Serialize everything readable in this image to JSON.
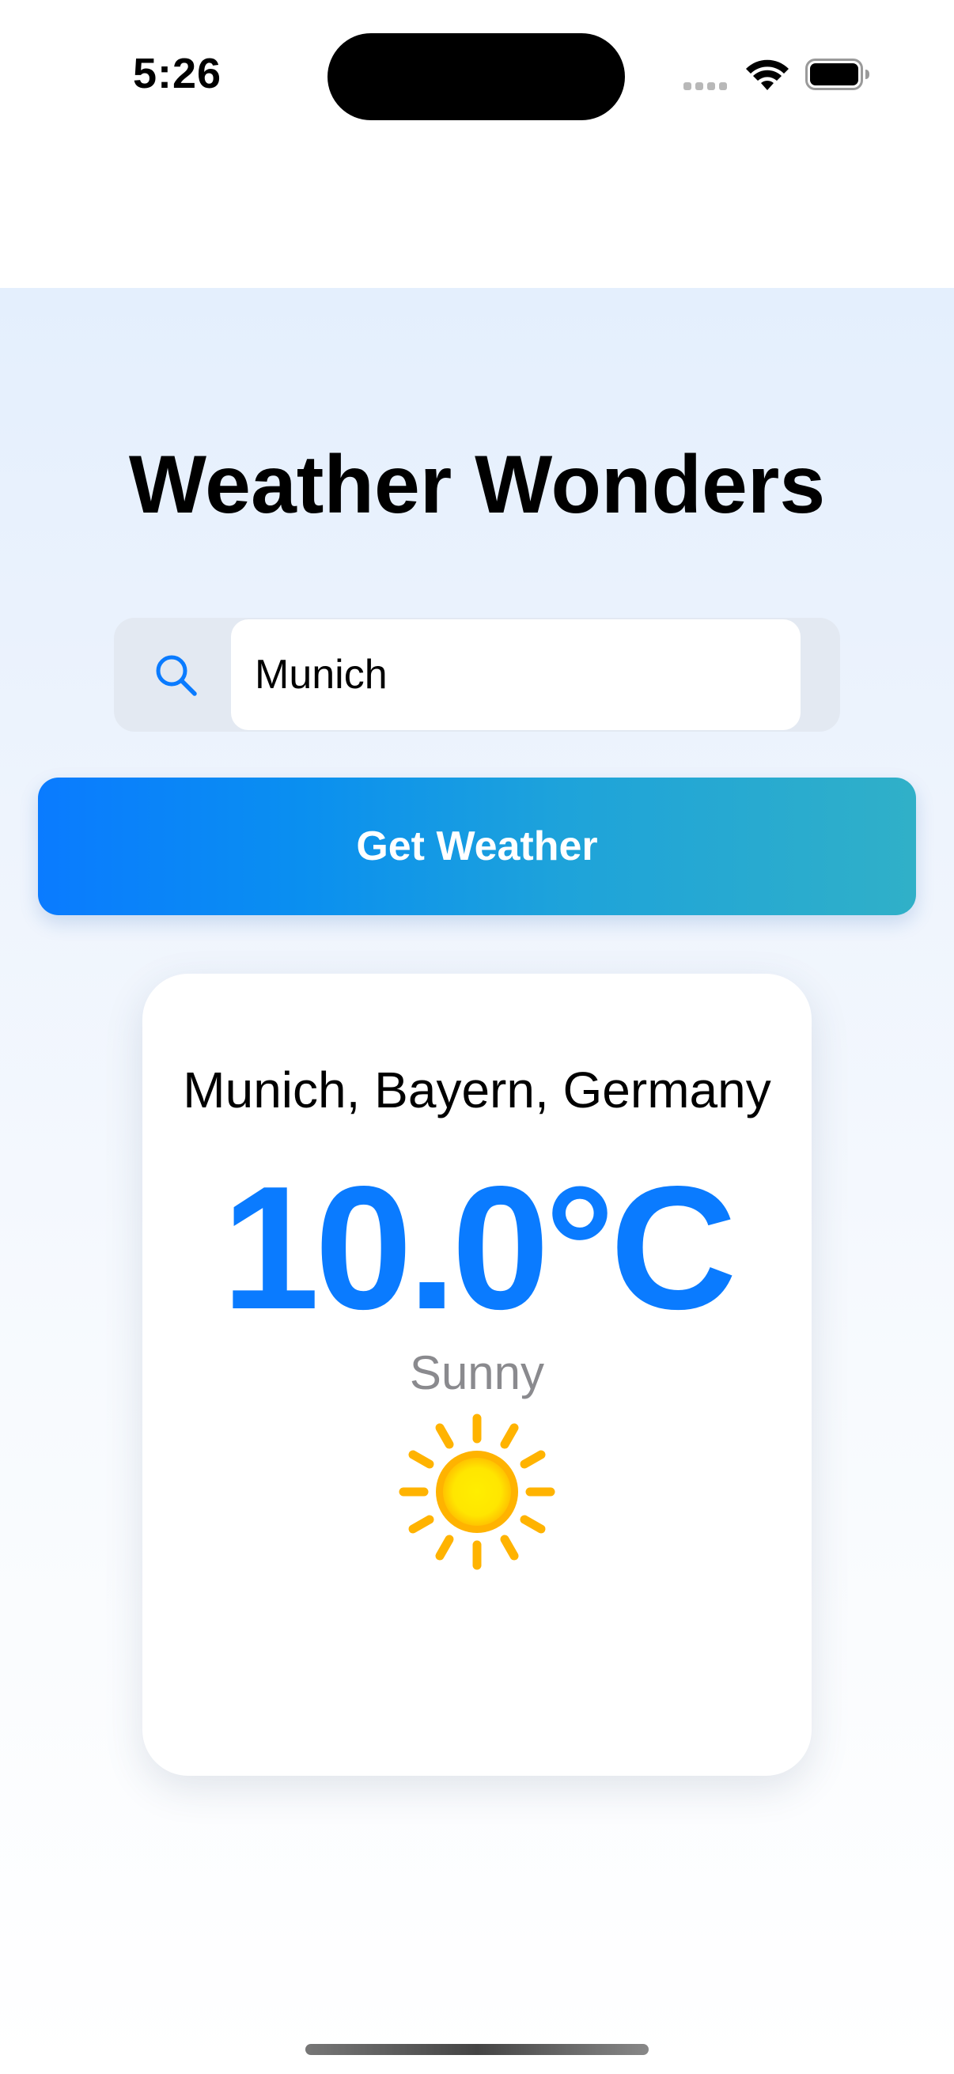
{
  "status_bar": {
    "time": "5:26"
  },
  "app": {
    "title": "Weather Wonders"
  },
  "search": {
    "value": "Munich",
    "icon": "search-icon"
  },
  "button": {
    "label": "Get Weather"
  },
  "weather": {
    "location": "Munich, Bayern, Germany",
    "temperature": "10.0°C",
    "condition": "Sunny",
    "icon": "sun-icon"
  },
  "colors": {
    "accent": "#0a7bff",
    "button_gradient_start": "#0a7bff",
    "button_gradient_end": "#30b0c8",
    "condition_text": "#8a8a8e",
    "sun_core": "#ffe600",
    "sun_rays": "#ffb300"
  }
}
